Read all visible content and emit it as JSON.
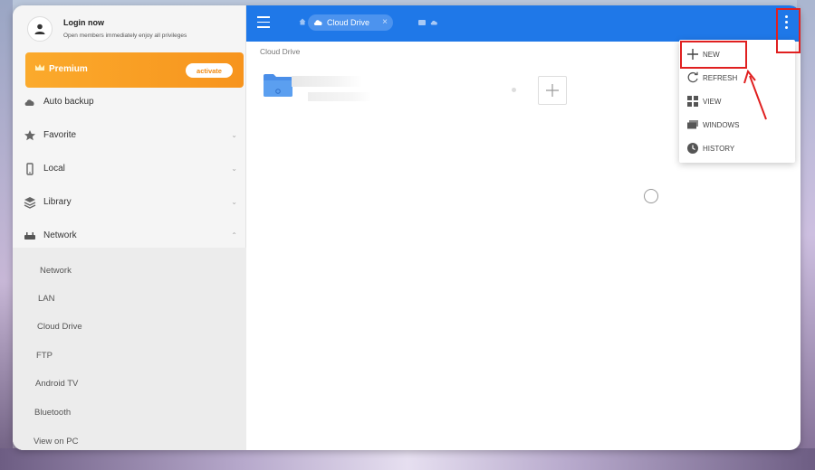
{
  "sidebar": {
    "login": {
      "title": "Login now",
      "subtitle": "Open members immediately enjoy all privileges"
    },
    "premium": {
      "label": "Premium",
      "action": "activate"
    },
    "items": [
      {
        "label": "Auto backup",
        "icon": "cloud-upload-icon"
      },
      {
        "label": "Favorite",
        "icon": "star-icon"
      },
      {
        "label": "Local",
        "icon": "phone-icon"
      },
      {
        "label": "Library",
        "icon": "stack-icon"
      },
      {
        "label": "Network",
        "icon": "router-icon"
      }
    ],
    "network_subitems": [
      "Network",
      "LAN",
      "Cloud Drive",
      "FTP",
      "Android TV",
      "Bluetooth",
      "View on PC"
    ]
  },
  "topbar": {
    "breadcrumb": "Cloud Drive",
    "accent": "#1f78e8"
  },
  "main": {
    "path_label": "Cloud Drive"
  },
  "dropdown": {
    "items": [
      {
        "label": "NEW",
        "icon": "plus-icon"
      },
      {
        "label": "REFRESH",
        "icon": "refresh-icon"
      },
      {
        "label": "VIEW",
        "icon": "grid-view-icon"
      },
      {
        "label": "WINDOWS",
        "icon": "windows-icon"
      },
      {
        "label": "HISTORY",
        "icon": "clock-icon"
      }
    ]
  },
  "colors": {
    "premium": "#f7941d",
    "highlight": "#e02020"
  }
}
